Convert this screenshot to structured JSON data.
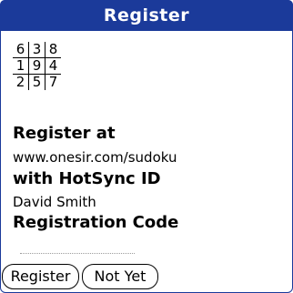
{
  "window": {
    "title": "Register"
  },
  "sudoku_grid": {
    "rows": [
      [
        "6",
        "3",
        "8"
      ],
      [
        "1",
        "9",
        "4"
      ],
      [
        "2",
        "5",
        "7"
      ]
    ]
  },
  "content": {
    "register_at_heading": "Register at",
    "url": "www.onesir.com/sudoku",
    "hotsync_heading": "with HotSync ID",
    "hotsync_id": "David Smith",
    "registration_code_heading": "Registration Code",
    "registration_code_value": ""
  },
  "buttons": {
    "register_label": "Register",
    "not_yet_label": "Not Yet"
  },
  "colors": {
    "titlebar": "#1b3a9a",
    "text": "#000000",
    "background": "#ffffff"
  }
}
